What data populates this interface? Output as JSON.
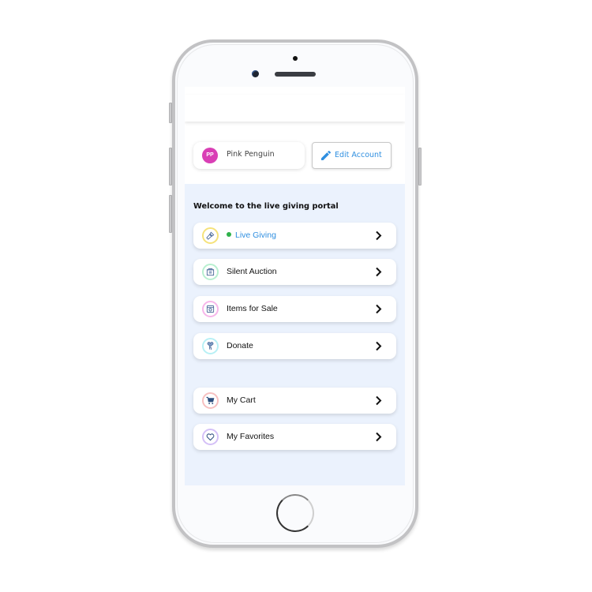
{
  "profile": {
    "initials": "PP",
    "name": "Pink Penguin",
    "avatar_color": "#d93fb5"
  },
  "edit_account": {
    "label": "Edit Account",
    "icon": "pencil-icon",
    "color": "#2f8fe0"
  },
  "portal": {
    "welcome": "Welcome to the live giving portal",
    "items": [
      {
        "label": "Live Giving",
        "icon": "microphone-icon",
        "ring_color": "#f5e27a",
        "status_dot": "#2eb14a",
        "label_color": "#2f8fe0"
      },
      {
        "label": "Silent Auction",
        "icon": "auction-icon",
        "ring_color": "#b8f0d0"
      },
      {
        "label": "Items for Sale",
        "icon": "store-icon",
        "ring_color": "#f7b6ea"
      },
      {
        "label": "Donate",
        "icon": "donate-heart-icon",
        "ring_color": "#b8f0f5"
      }
    ],
    "secondary_items": [
      {
        "label": "My Cart",
        "icon": "cart-icon",
        "ring_color": "#f7c0c0"
      },
      {
        "label": "My Favorites",
        "icon": "heart-icon",
        "ring_color": "#d4c0f7"
      }
    ]
  }
}
